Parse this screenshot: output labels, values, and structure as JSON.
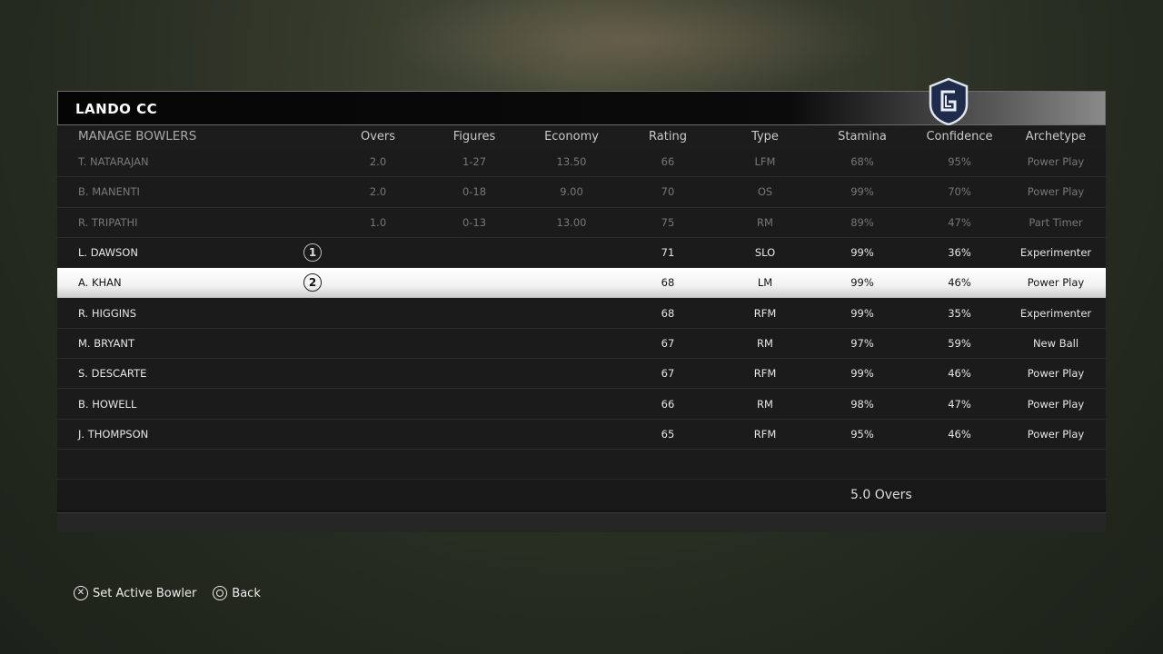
{
  "header": {
    "team_name": "LANDO CC"
  },
  "table": {
    "columns": {
      "name": "MANAGE BOWLERS",
      "overs": "Overs",
      "figures": "Figures",
      "economy": "Economy",
      "rating": "Rating",
      "type": "Type",
      "stamina": "Stamina",
      "confidence": "Confidence",
      "archetype": "Archetype"
    },
    "rows": [
      {
        "name": "T. NATARAJAN",
        "order": "",
        "overs": "2.0",
        "figures": "1-27",
        "economy": "13.50",
        "rating": "66",
        "type": "LFM",
        "stamina": "68%",
        "confidence": "95%",
        "archetype": "Power Play",
        "state": "done"
      },
      {
        "name": "B. MANENTI",
        "order": "",
        "overs": "2.0",
        "figures": "0-18",
        "economy": "9.00",
        "rating": "70",
        "type": "OS",
        "stamina": "99%",
        "confidence": "70%",
        "archetype": "Power Play",
        "state": "done"
      },
      {
        "name": "R. TRIPATHI",
        "order": "",
        "overs": "1.0",
        "figures": "0-13",
        "economy": "13.00",
        "rating": "75",
        "type": "RM",
        "stamina": "89%",
        "confidence": "47%",
        "archetype": "Part Timer",
        "state": "done"
      },
      {
        "name": "L. DAWSON",
        "order": "1",
        "overs": "",
        "figures": "",
        "economy": "",
        "rating": "71",
        "type": "SLO",
        "stamina": "99%",
        "confidence": "36%",
        "archetype": "Experimenter",
        "state": "normal"
      },
      {
        "name": "A. KHAN",
        "order": "2",
        "overs": "",
        "figures": "",
        "economy": "",
        "rating": "68",
        "type": "LM",
        "stamina": "99%",
        "confidence": "46%",
        "archetype": "Power Play",
        "state": "selected"
      },
      {
        "name": "R. HIGGINS",
        "order": "",
        "overs": "",
        "figures": "",
        "economy": "",
        "rating": "68",
        "type": "RFM",
        "stamina": "99%",
        "confidence": "35%",
        "archetype": "Experimenter",
        "state": "normal"
      },
      {
        "name": "M. BRYANT",
        "order": "",
        "overs": "",
        "figures": "",
        "economy": "",
        "rating": "67",
        "type": "RM",
        "stamina": "97%",
        "confidence": "59%",
        "archetype": "New Ball",
        "state": "normal"
      },
      {
        "name": "S. DESCARTE",
        "order": "",
        "overs": "",
        "figures": "",
        "economy": "",
        "rating": "67",
        "type": "RFM",
        "stamina": "99%",
        "confidence": "46%",
        "archetype": "Power Play",
        "state": "normal"
      },
      {
        "name": "B. HOWELL",
        "order": "",
        "overs": "",
        "figures": "",
        "economy": "",
        "rating": "66",
        "type": "RM",
        "stamina": "98%",
        "confidence": "47%",
        "archetype": "Power Play",
        "state": "normal"
      },
      {
        "name": "J. THOMPSON",
        "order": "",
        "overs": "",
        "figures": "",
        "economy": "",
        "rating": "65",
        "type": "RFM",
        "stamina": "95%",
        "confidence": "46%",
        "archetype": "Power Play",
        "state": "normal"
      }
    ],
    "total_overs": "5.0 Overs"
  },
  "footer": {
    "set_active_label": "Set Active Bowler",
    "set_active_icon": "cross-button-icon",
    "back_label": "Back",
    "back_icon": "circle-button-icon"
  },
  "colors": {
    "selected_row": "#ffffff",
    "panel": "#141414",
    "team_badge": "#1f2b4a"
  }
}
